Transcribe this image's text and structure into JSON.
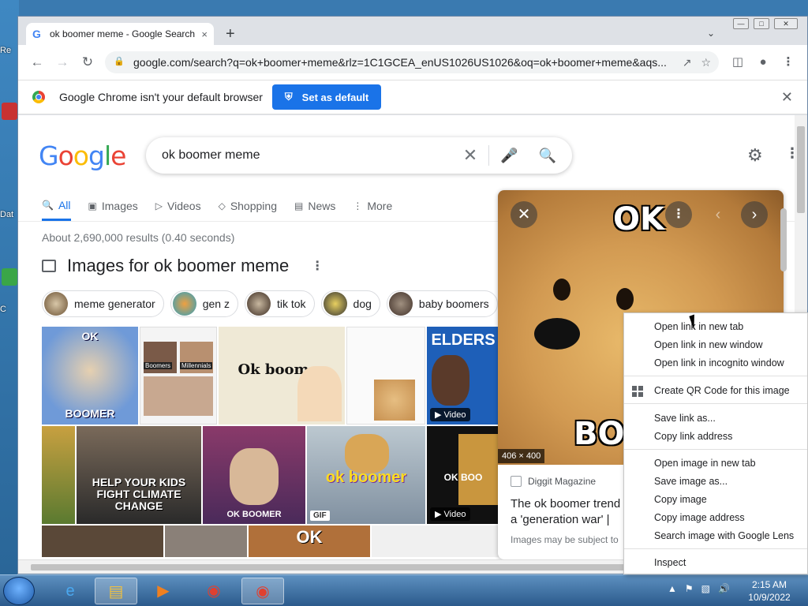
{
  "desktop": {
    "labels": [
      "Re",
      "Dat",
      "C"
    ]
  },
  "browser": {
    "tab_title": "ok boomer meme - Google Search",
    "tab_close": "×",
    "new_tab": "+",
    "url": "google.com/search?q=ok+boomer+meme&rlz=1C1GCEA_enUS1026US1026&oq=ok+boomer+meme&aqs...",
    "infobar_text": "Google Chrome isn't your default browser",
    "set_default_label": "Set as default"
  },
  "page": {
    "logo": {
      "G": "G",
      "o1": "o",
      "o2": "o",
      "g": "g",
      "l": "l",
      "e": "e"
    },
    "query": "ok boomer meme",
    "tabs": [
      {
        "label": "All",
        "icon": "search-icon"
      },
      {
        "label": "Images",
        "icon": "image-icon"
      },
      {
        "label": "Videos",
        "icon": "play-icon"
      },
      {
        "label": "Shopping",
        "icon": "tag-icon"
      },
      {
        "label": "News",
        "icon": "news-icon"
      },
      {
        "label": "More",
        "icon": "more-icon"
      }
    ],
    "stats": "About 2,690,000 results (0.40 seconds)",
    "images_heading": "Images for ok boomer meme",
    "chips": [
      "meme generator",
      "gen z",
      "tik tok",
      "dog",
      "baby boomers"
    ],
    "thumbs": {
      "t1": "OK",
      "t1b": "BOOMER",
      "t2a": "Boomers",
      "t2b": "Millennials",
      "t3": "Ok boomer",
      "t5": "ELDERS",
      "t5v": "Video",
      "t7": "HELP YOUR KIDS FIGHT CLIMATE CHANGE",
      "t8": "OK BOOMER",
      "t9": "ok boomer",
      "t9b": "GIF",
      "t10": "OK BOO",
      "t10v": "Video",
      "t11": "OK"
    }
  },
  "preview": {
    "top_text": "OK",
    "bottom_text": "BOO",
    "dimensions": "406 × 400",
    "source": "Diggit Magazine",
    "title": "The ok boomer trend a 'generation war' |",
    "note": "Images may be subject to"
  },
  "context_menu": [
    "Open link in new tab",
    "Open link in new window",
    "Open link in incognito window",
    "Create QR Code for this image",
    "Save link as...",
    "Copy link address",
    "Open image in new tab",
    "Save image as...",
    "Copy image",
    "Copy image address",
    "Search image with Google Lens",
    "Inspect"
  ],
  "taskbar": {
    "time": "2:15 AM",
    "date": "10/9/2022"
  }
}
